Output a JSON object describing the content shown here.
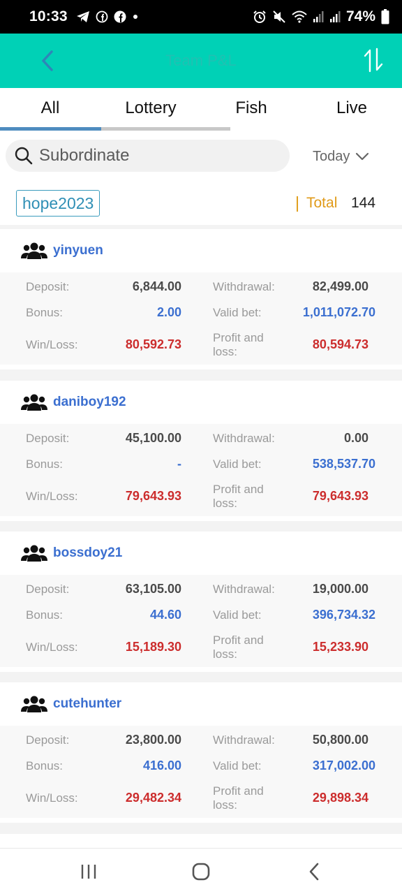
{
  "statusbar": {
    "time": "10:33",
    "battery": "74%"
  },
  "header": {
    "title": "Team P&L"
  },
  "tabs": [
    {
      "label": "All"
    },
    {
      "label": "Lottery"
    },
    {
      "label": "Fish"
    },
    {
      "label": "Live"
    }
  ],
  "search": {
    "placeholder": "Subordinate"
  },
  "period": {
    "label": "Today"
  },
  "summary": {
    "user": "hope2023",
    "total_label": "Total",
    "total_value": "144"
  },
  "labels": {
    "deposit": "Deposit:",
    "withdrawal": "Withdrawal:",
    "bonus": "Bonus:",
    "valid_bet": "Valid bet:",
    "win_loss": "Win/Loss:",
    "pnl_line1": "Profit and",
    "pnl_line2": "loss:"
  },
  "members": [
    {
      "name": "yinyuen",
      "deposit": "6,844.00",
      "withdrawal": "82,499.00",
      "bonus": "2.00",
      "valid_bet": "1,011,072.70",
      "win_loss": "80,592.73",
      "profit_loss": "80,594.73"
    },
    {
      "name": "daniboy192",
      "deposit": "45,100.00",
      "withdrawal": "0.00",
      "bonus": "-",
      "valid_bet": "538,537.70",
      "win_loss": "79,643.93",
      "profit_loss": "79,643.93"
    },
    {
      "name": "bossdoy21",
      "deposit": "63,105.00",
      "withdrawal": "19,000.00",
      "bonus": "44.60",
      "valid_bet": "396,734.32",
      "win_loss": "15,189.30",
      "profit_loss": "15,233.90"
    },
    {
      "name": "cutehunter",
      "deposit": "23,800.00",
      "withdrawal": "50,800.00",
      "bonus": "416.00",
      "valid_bet": "317,002.00",
      "win_loss": "29,482.34",
      "profit_loss": "29,898.34"
    }
  ],
  "colors": {
    "accent": "#00d1b6",
    "tab_active": "#4e8cbf",
    "name_blue": "#3b6fd0",
    "loss_red": "#cc2d2d",
    "total_orange": "#e09a18"
  }
}
